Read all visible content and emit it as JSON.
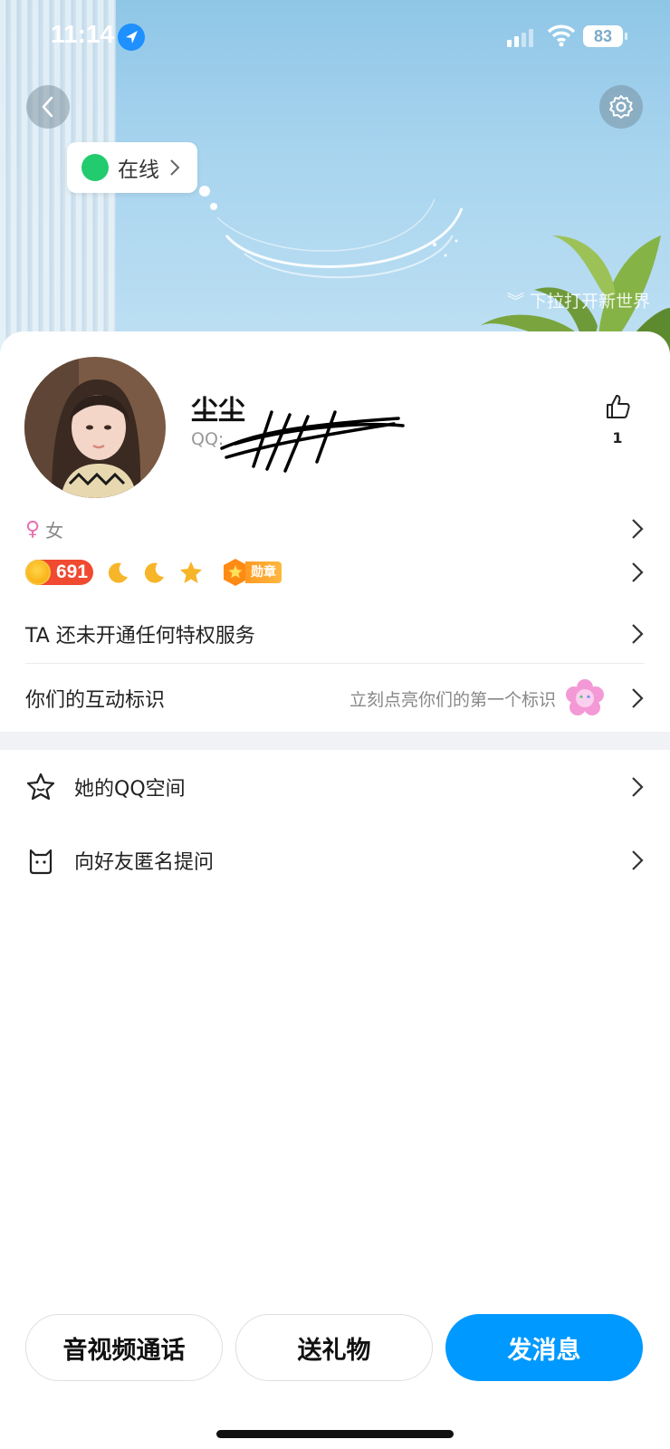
{
  "status_bar": {
    "time": "11:14",
    "battery": "83"
  },
  "banner": {
    "online_status": "在线",
    "pull_hint": "下拉打开新世界"
  },
  "profile": {
    "name": "尘尘",
    "qq_label": "QQ:",
    "like_count": "1",
    "gender": "女",
    "level": "691",
    "medal_label": "勋章"
  },
  "rows": {
    "privilege": "TA 还未开通任何特权服务",
    "interaction_label": "你们的互动标识",
    "interaction_hint": "立刻点亮你们的第一个标识"
  },
  "menu": [
    {
      "label": "她的QQ空间",
      "icon": "star-face-icon"
    },
    {
      "label": "向好友匿名提问",
      "icon": "cat-icon"
    }
  ],
  "actions": {
    "call": "音视频通话",
    "gift": "送礼物",
    "message": "发消息"
  },
  "colors": {
    "accent": "#0099ff",
    "online": "#22cc6e",
    "level_badge": "#f04a31"
  }
}
